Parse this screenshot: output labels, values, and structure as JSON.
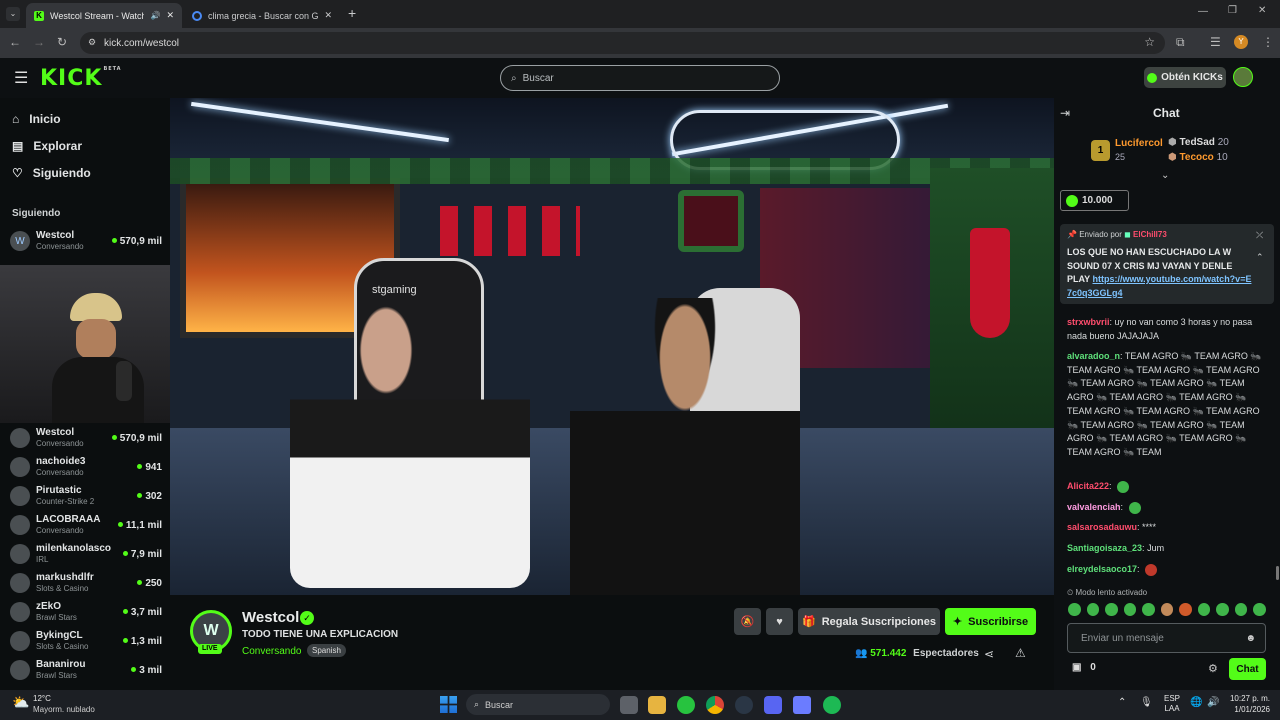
{
  "browser": {
    "tabs": [
      {
        "title": "Westcol Stream - Watch Li",
        "active": true
      },
      {
        "title": "clima grecia - Buscar con Goog",
        "active": false
      }
    ],
    "url": "kick.com/westcol"
  },
  "header": {
    "logo": "KICK",
    "beta": "BETA",
    "search_placeholder": "Buscar",
    "kicks_button": "Obtén KICKs"
  },
  "sidebar": {
    "nav": [
      {
        "label": "Inicio",
        "icon": "home-icon"
      },
      {
        "label": "Explorar",
        "icon": "explore-icon"
      },
      {
        "label": "Siguiendo",
        "icon": "heart-icon"
      }
    ],
    "following_title": "Siguiendo",
    "top_channel": {
      "name": "Westcol",
      "category": "Conversando",
      "viewers": "570,9 mil"
    },
    "channels": [
      {
        "name": "Westcol",
        "category": "Conversando",
        "viewers": "570,9 mil"
      },
      {
        "name": "nachoide3",
        "category": "Conversando",
        "viewers": "941"
      },
      {
        "name": "Pirutastic",
        "category": "Counter-Strike 2",
        "viewers": "302"
      },
      {
        "name": "LACOBRAAA",
        "category": "Conversando",
        "viewers": "11,1 mil"
      },
      {
        "name": "milenkanolasco",
        "category": "IRL",
        "viewers": "7,9 mil"
      },
      {
        "name": "markushdlfr",
        "category": "Slots & Casino",
        "viewers": "250"
      },
      {
        "name": "zEkO",
        "category": "Brawl Stars",
        "viewers": "3,7 mil"
      },
      {
        "name": "BykingCL",
        "category": "Slots & Casino",
        "viewers": "1,3 mil"
      },
      {
        "name": "Bananirou",
        "category": "Brawl Stars",
        "viewers": "3 mil"
      }
    ]
  },
  "stream": {
    "channel": "Westcol",
    "title": "TODO TIENE UNA EXPLICACION",
    "category": "Conversando",
    "language": "Spanish",
    "live_badge": "LIVE",
    "gift_button": "Regala Suscripciones",
    "subscribe_button": "Suscribirse",
    "viewers": "571.442",
    "viewers_label": "Espectadores",
    "chair_brand": "stgaming"
  },
  "chat": {
    "title": "Chat",
    "leaderboard": [
      {
        "rank": "1",
        "name": "Lucifercol",
        "points": "25"
      },
      {
        "name": "TedSad",
        "points": "20"
      },
      {
        "name": "Tecoco",
        "points": "10"
      }
    ],
    "kicks_amount": "10.000",
    "pinned": {
      "by_label": "Enviado por",
      "by_user": "ElChill73",
      "text": "LOS QUE NO HAN ESCUCHADO LA W SOUND 07 X CRIS MJ VAYAN Y DENLE PLAY ",
      "link": "https://www.youtube.com/watch?v=E7c0q3GGLg4"
    },
    "messages": [
      {
        "user": "strxwbvrii",
        "color": "#ff4d6d",
        "text": "uy no van como 3 horas y no pasa nada bueno JAJAJAJA"
      },
      {
        "user": "alvaradoo_n",
        "color": "#5ee07a",
        "text": "TEAM AGRO 🐜 TEAM AGRO 🐜 TEAM AGRO 🐜 TEAM AGRO 🐜 TEAM AGRO 🐜 TEAM AGRO 🐜 TEAM AGRO 🐜 TEAM AGRO 🐜 TEAM AGRO 🐜 TEAM AGRO 🐜 TEAM AGRO 🐜 TEAM AGRO 🐜 TEAM AGRO 🐜 TEAM AGRO 🐜 TEAM AGRO 🐜 TEAM AGRO 🐜 TEAM AGRO 🐜 TEAM AGRO 🐜 TEAM AGRO 🐜 TEAM"
      },
      {
        "user": "Alicita222",
        "color": "#ff4d6d",
        "text": ""
      },
      {
        "user": "valvalenciah",
        "color": "#ff9de2",
        "text": ""
      },
      {
        "user": "salsarosadauwu",
        "color": "#ff4d6d",
        "text": "****"
      },
      {
        "user": "Santiagoisaza_23",
        "color": "#5ee07a",
        "text": "Jum"
      },
      {
        "user": "elreydelsaoco17",
        "color": "#5ee07a",
        "text": ""
      }
    ],
    "slow_mode": "Modo lento activado",
    "input_placeholder": "Enviar un mensaje",
    "points": "0",
    "send_button": "Chat"
  },
  "taskbar": {
    "weather_temp": "12°C",
    "weather_desc": "Mayorm. nublado",
    "search_placeholder": "Buscar",
    "lang": "ESP",
    "lang2": "LAA",
    "time": "10:27 p. m.",
    "date": "1/01/2026"
  },
  "colors": {
    "accent": "#53fc18",
    "background": "#0b0e0f"
  }
}
